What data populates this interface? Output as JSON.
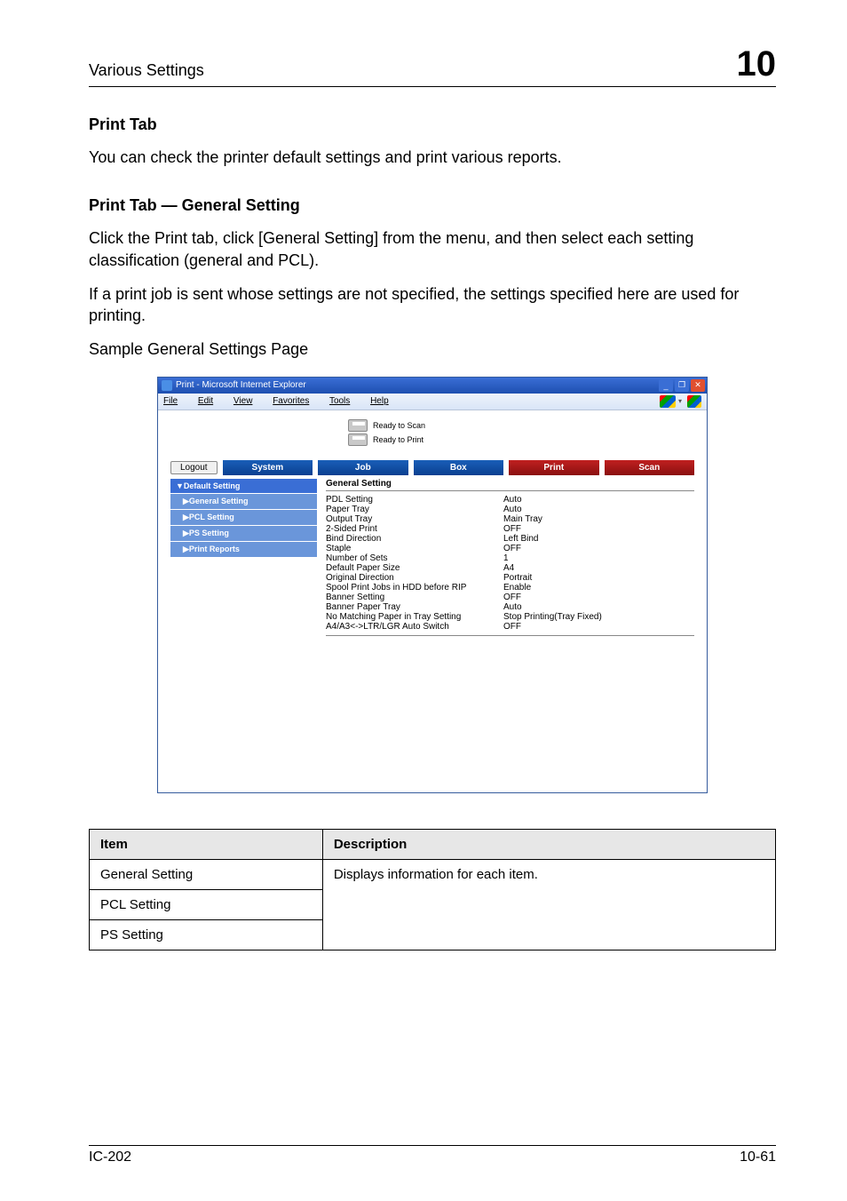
{
  "header": {
    "title": "Various Settings",
    "chapter_number": "10"
  },
  "sections": {
    "print_tab": {
      "heading": "Print Tab",
      "body": "You can check the printer default settings and print various reports."
    },
    "print_tab_general": {
      "heading": "Print Tab — General Setting",
      "p1": "Click the Print tab, click [General Setting] from the menu, and then select each setting classification (general and PCL).",
      "p2": "If a print job is sent whose settings are not specified, the settings specified here are used for printing.",
      "p3": "Sample General Settings Page"
    }
  },
  "screenshot": {
    "window_title": "Print - Microsoft Internet Explorer",
    "menubar": [
      "File",
      "Edit",
      "View",
      "Favorites",
      "Tools",
      "Help"
    ],
    "ready": {
      "scan": "Ready to Scan",
      "print": "Ready to Print"
    },
    "logout": "Logout",
    "tabs": {
      "system": "System",
      "job": "Job",
      "box": "Box",
      "print": "Print",
      "scan": "Scan"
    },
    "sidemenu": {
      "default_setting": "▼Default Setting",
      "general": "▶General Setting",
      "pcl": "▶PCL Setting",
      "ps": "▶PS Setting",
      "reports": "▶Print Reports"
    },
    "content_heading": "General Setting",
    "rows": [
      {
        "k": "PDL Setting",
        "v": "Auto"
      },
      {
        "k": "Paper Tray",
        "v": "Auto"
      },
      {
        "k": "Output Tray",
        "v": "Main Tray"
      },
      {
        "k": "2-Sided Print",
        "v": "OFF"
      },
      {
        "k": "Bind Direction",
        "v": "Left Bind"
      },
      {
        "k": "Staple",
        "v": "OFF"
      },
      {
        "k": "Number of Sets",
        "v": "1"
      },
      {
        "k": "Default Paper Size",
        "v": "A4"
      },
      {
        "k": "Original Direction",
        "v": "Portrait"
      },
      {
        "k": "Spool Print Jobs in HDD before RIP",
        "v": "Enable"
      },
      {
        "k": "Banner Setting",
        "v": "OFF"
      },
      {
        "k": "Banner Paper Tray",
        "v": "Auto"
      },
      {
        "k": "No Matching Paper in Tray Setting",
        "v": "Stop Printing(Tray Fixed)"
      },
      {
        "k": "A4/A3<->LTR/LGR Auto Switch",
        "v": "OFF"
      }
    ]
  },
  "info_table": {
    "head_item": "Item",
    "head_desc": "Description",
    "rows": {
      "general": "General Setting",
      "pcl": "PCL Setting",
      "ps": "PS Setting"
    },
    "desc": "Displays information for each item."
  },
  "footer": {
    "left": "IC-202",
    "right": "10-61"
  }
}
